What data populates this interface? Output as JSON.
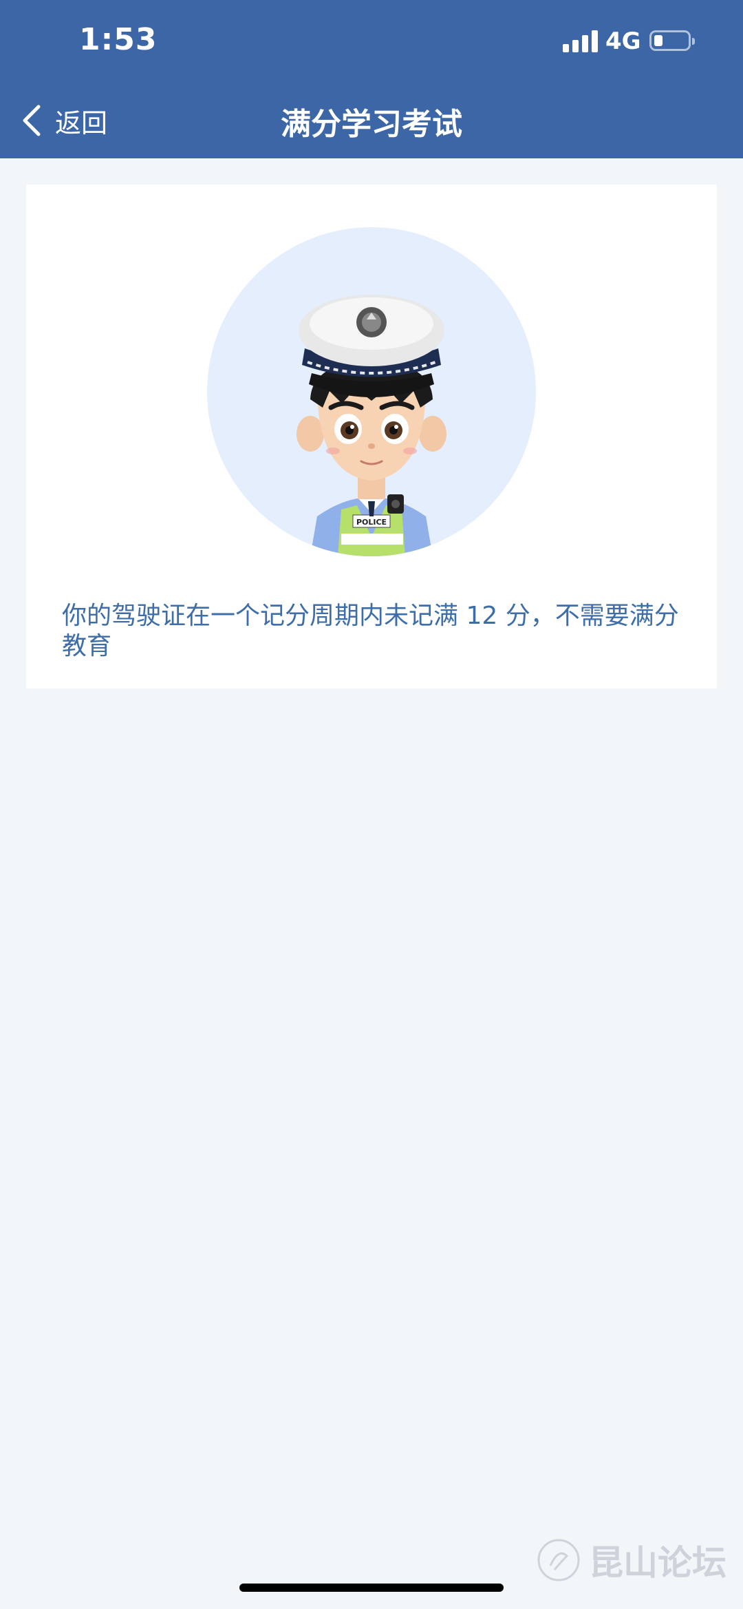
{
  "status_bar": {
    "time": "1:53",
    "network": "4G"
  },
  "nav": {
    "back_label": "返回",
    "title": "满分学习考试"
  },
  "card": {
    "avatar_badge_text": "POLICE",
    "message": "你的驾驶证在一个记分周期内未记满 12 分，不需要满分教育"
  },
  "watermark": {
    "text": "昆山论坛"
  },
  "colors": {
    "header": "#3c66a5",
    "page_bg": "#f3f6f8",
    "message_text": "#3d6ea9",
    "avatar_bg": "#e4eefc"
  }
}
